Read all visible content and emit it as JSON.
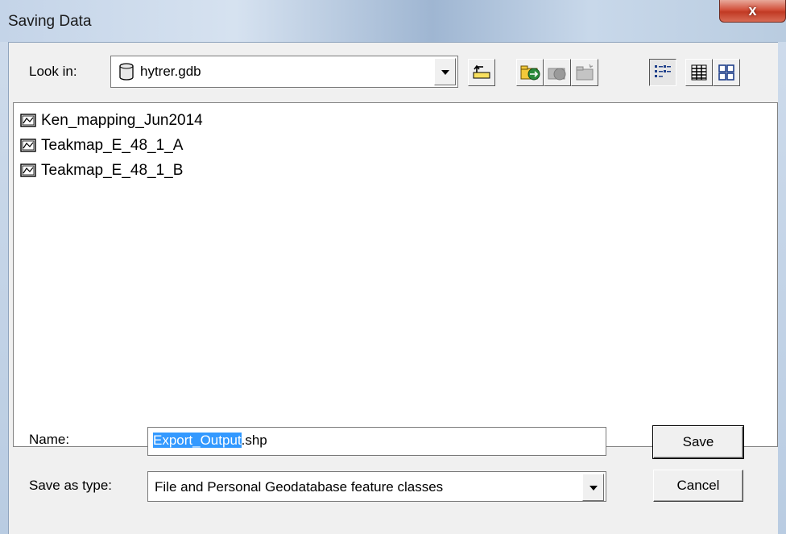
{
  "window": {
    "title": "Saving Data",
    "close_label": "x"
  },
  "lookin": {
    "label": "Look in:",
    "value": "hytrer.gdb",
    "icon": "database-icon"
  },
  "toolbar": [
    {
      "name": "up-one-level-button",
      "icon": "folder-up-icon"
    },
    {
      "name": "connect-folder-button",
      "icon": "connect-folder-icon"
    },
    {
      "name": "disconnect-folder-button",
      "icon": "disconnect-folder-icon",
      "disabled": true
    },
    {
      "name": "new-folder-button",
      "icon": "new-folder-icon",
      "disabled": true
    },
    {
      "name": "list-view-button",
      "icon": "list-view-icon",
      "active": true
    },
    {
      "name": "details-view-button",
      "icon": "details-view-icon"
    },
    {
      "name": "thumbnails-view-button",
      "icon": "thumbnails-view-icon"
    }
  ],
  "files": [
    {
      "name": "Ken_mapping_Jun2014",
      "icon": "feature-dataset-icon"
    },
    {
      "name": "Teakmap_E_48_1_A",
      "icon": "feature-dataset-icon"
    },
    {
      "name": "Teakmap_E_48_1_B",
      "icon": "feature-dataset-icon"
    }
  ],
  "name_field": {
    "label": "Name:",
    "value_selected": "Export_Output",
    "value_rest": ".shp"
  },
  "save_as_type": {
    "label": "Save as type:",
    "value": "File and Personal Geodatabase feature classes"
  },
  "buttons": {
    "save": "Save",
    "cancel": "Cancel"
  },
  "colors": {
    "selection": "#3399ff",
    "close_button": "#c13a24"
  }
}
